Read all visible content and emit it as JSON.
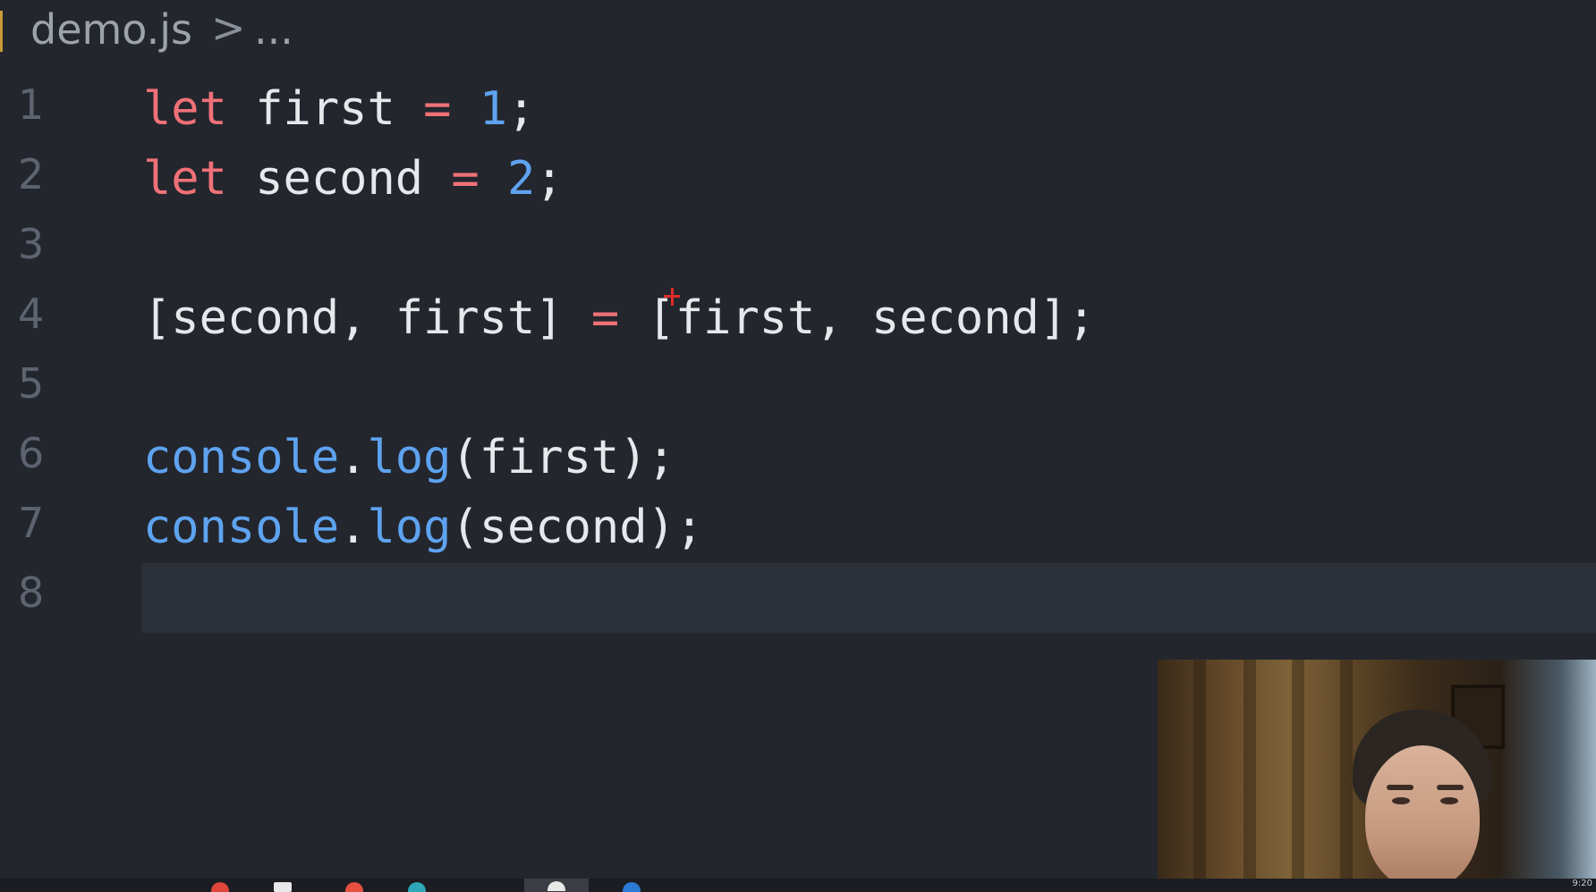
{
  "breadcrumb": {
    "file": "demo.js",
    "separator": ">",
    "more": "..."
  },
  "editor": {
    "line_numbers": [
      "1",
      "2",
      "3",
      "4",
      "5",
      "6",
      "7",
      "8"
    ],
    "lines": [
      [
        {
          "text": "let",
          "kind": "keyword"
        },
        {
          "text": " first ",
          "kind": "plain"
        },
        {
          "text": "=",
          "kind": "operator"
        },
        {
          "text": " ",
          "kind": "plain"
        },
        {
          "text": "1",
          "kind": "number"
        },
        {
          "text": ";",
          "kind": "plain"
        }
      ],
      [
        {
          "text": "let",
          "kind": "keyword"
        },
        {
          "text": " second ",
          "kind": "plain"
        },
        {
          "text": "=",
          "kind": "operator"
        },
        {
          "text": " ",
          "kind": "plain"
        },
        {
          "text": "2",
          "kind": "number"
        },
        {
          "text": ";",
          "kind": "plain"
        }
      ],
      [],
      [
        {
          "text": "[second, first] ",
          "kind": "plain"
        },
        {
          "text": "=",
          "kind": "operator"
        },
        {
          "text": " [first, second];",
          "kind": "plain"
        }
      ],
      [],
      [
        {
          "text": "console",
          "kind": "function"
        },
        {
          "text": ".",
          "kind": "plain"
        },
        {
          "text": "log",
          "kind": "function"
        },
        {
          "text": "(first);",
          "kind": "plain"
        }
      ],
      [
        {
          "text": "console",
          "kind": "function"
        },
        {
          "text": ".",
          "kind": "plain"
        },
        {
          "text": "log",
          "kind": "function"
        },
        {
          "text": "(second);",
          "kind": "plain"
        }
      ],
      []
    ],
    "current_line": 8
  },
  "colors": {
    "background": "#23262d",
    "keyword": "#f07178",
    "number": "#5ea3f0",
    "function": "#5ea3f0",
    "text": "#e6e8eb",
    "line_number": "#5d6470"
  },
  "taskbar": {
    "clock": "9:20"
  }
}
